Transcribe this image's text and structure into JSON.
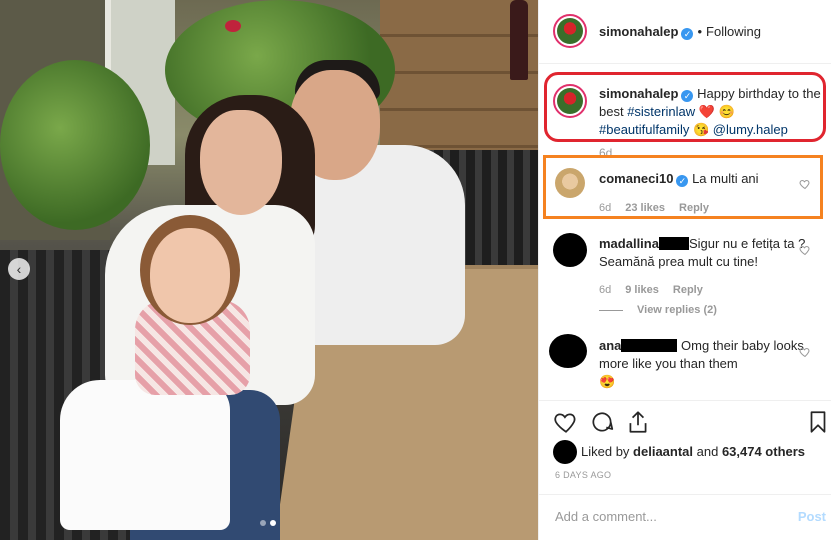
{
  "post": {
    "author": "simonahalep",
    "follow_separator": "•",
    "follow_status": "Following",
    "verified_badge": "✓"
  },
  "caption": {
    "author": "simonahalep",
    "text_before": "Happy birthday to the best ",
    "hashtag1": "#sisterinlaw",
    "emoji1": "❤️",
    "emoji2": "😊",
    "hashtag2": "#beautifulfamily",
    "emoji3": "😘",
    "mention": "@lumy.halep",
    "time": "6d"
  },
  "comments": [
    {
      "author": "comaneci10",
      "verified": true,
      "text": "La multi ani",
      "time": "6d",
      "likes": "23 likes",
      "reply": "Reply"
    },
    {
      "author": "madallina",
      "text": "Sigur nu e fetița ta ? Seamănă prea mult cu tine! ",
      "time": "6d",
      "likes": "9 likes",
      "reply": "Reply",
      "view_replies": "View replies (2)"
    },
    {
      "author": "ana",
      "text": "Omg their baby looks more like you than them",
      "emoji": "😍"
    }
  ],
  "likes": {
    "prefix": "Liked by ",
    "user": "deliaantal",
    "middle": " and ",
    "count": "63,474 others"
  },
  "date": "6 DAYS AGO",
  "add_comment": {
    "placeholder": "Add a comment...",
    "post": "Post"
  },
  "icons": {
    "like": "heart-icon",
    "comment": "comment-icon",
    "share": "share-icon",
    "save": "bookmark-icon",
    "prev": "chevron-left-icon"
  },
  "colors": {
    "caption_highlight": "#e0252f",
    "comment_highlight": "#f58220",
    "link": "#003569",
    "verified": "#3897f0"
  },
  "photo": {
    "nav_prev": "‹",
    "carousel_slides": 2,
    "active_slide": 2
  }
}
